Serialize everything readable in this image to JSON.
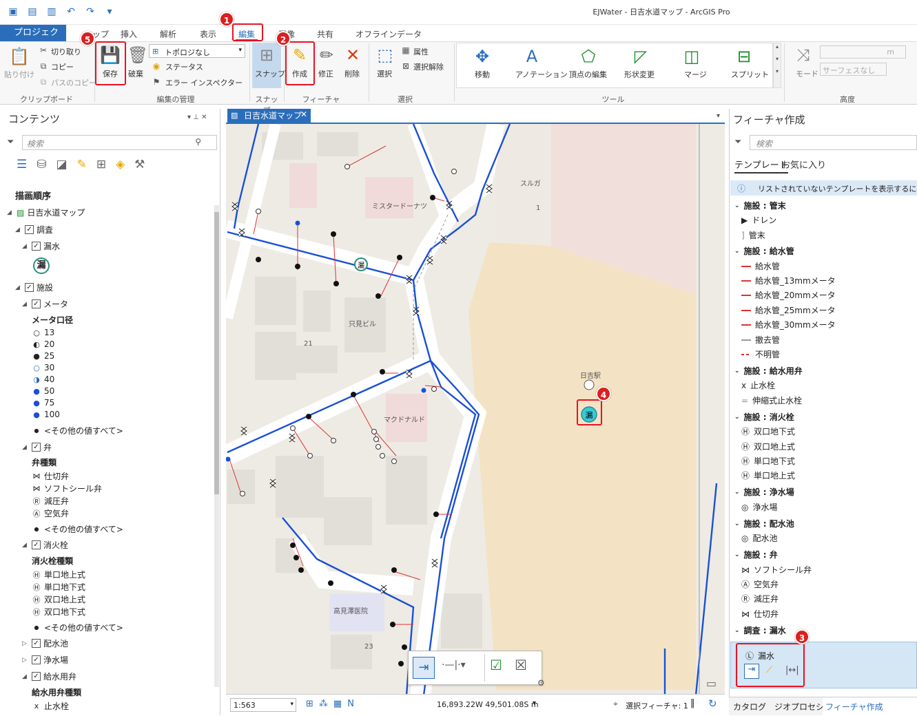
{
  "window": {
    "title": "EJWater - 日吉水道マップ - ArcGIS Pro"
  },
  "tabs": {
    "project": "プロジェクト",
    "map": "マップ",
    "insert": "挿入",
    "analysis": "解析",
    "view": "表示",
    "edit": "編集",
    "imagery": "画像",
    "share": "共有",
    "offline": "オフラインデータ"
  },
  "ribbon": {
    "paste": "貼り付け",
    "cut": "切り取り",
    "copy": "コピー",
    "copy_path": "パスのコピー",
    "clipboard": "クリップボード",
    "save": "保存",
    "discard": "破棄",
    "topology": "トポロジなし",
    "status": "ステータス",
    "error_inspector": "エラー インスペクター",
    "manage_edits": "編集の管理",
    "snap": "スナップ",
    "snapping": "スナップ",
    "create": "作成",
    "modify": "修正",
    "delete": "削除",
    "features": "フィーチャ",
    "select": "選択",
    "attributes": "属性",
    "clear": "選択解除",
    "selection": "選択",
    "move": "移動",
    "annotation": "アノテーション",
    "edit_vertices": "頂点の編集",
    "reshape": "形状変更",
    "merge": "マージ",
    "split": "スプリット",
    "tools": "ツール",
    "mode": "モード",
    "surface": "サーフェスなし",
    "unit": "m",
    "elevation": "高度"
  },
  "badges": [
    "1",
    "2",
    "3",
    "4",
    "5"
  ],
  "contents": {
    "title": "コンテンツ",
    "search_placeholder": "検索",
    "drawing_order": "描画順序",
    "map_name": "日吉水道マップ",
    "survey": "調査",
    "leak": "漏水",
    "leak_symbol": "漏",
    "facilities": "施設",
    "meter": "メータ",
    "meter_field": "メータ口径",
    "meter_classes": [
      "13",
      "20",
      "25",
      "30",
      "40",
      "50",
      "75",
      "100"
    ],
    "other": "<その他の値すべて>",
    "valve": "弁",
    "valve_field": "弁種類",
    "valve_classes": [
      "仕切弁",
      "ソフトシール弁",
      "減圧弁",
      "空気弁"
    ],
    "hydrant": "消火栓",
    "hydrant_field": "消火栓種類",
    "hydrant_classes": [
      "単口地上式",
      "単口地下式",
      "双口地上式",
      "双口地下式"
    ],
    "reservoir": "配水池",
    "plant": "浄水場",
    "supply_valve": "給水用弁",
    "supply_valve_field": "給水用弁種類",
    "stop_cock": "止水栓"
  },
  "map": {
    "tab": "日吉水道マップ",
    "labels": {
      "suruga": "スルガ",
      "one": "1",
      "mister_donut": "ミスタードーナツ",
      "tadami": "只見ビル",
      "n21": "21",
      "station": "日吉駅",
      "mcd": "マクドナルド",
      "clinic": "高見澤医院",
      "n23": "23",
      "leak": "漏"
    }
  },
  "statusbar": {
    "scale": "1:563",
    "coords": "16,893.22W 49,501.08S m",
    "selected": "選択フィーチャ: 1"
  },
  "create_panel": {
    "title": "フィーチャ作成",
    "search_placeholder": "検索",
    "tab_templates": "テンプレート",
    "tab_favorites": "お気に入り",
    "info": "リストされていないテンプレートを表示するには、ここ",
    "groups": [
      {
        "title": "施設 : 管末",
        "items": [
          "ドレン",
          "管末"
        ]
      },
      {
        "title": "施設 : 給水管",
        "items": [
          "給水管",
          "給水管_13mmメータ",
          "給水管_20mmメータ",
          "給水管_25mmメータ",
          "給水管_30mmメータ",
          "撤去管",
          "不明管"
        ]
      },
      {
        "title": "施設 : 給水用弁",
        "items": [
          "止水栓",
          "伸縮式止水栓"
        ]
      },
      {
        "title": "施設 : 消火栓",
        "items": [
          "双口地下式",
          "双口地上式",
          "単口地下式",
          "単口地上式"
        ]
      },
      {
        "title": "施設 : 浄水場",
        "items": [
          "浄水場"
        ]
      },
      {
        "title": "施設 : 配水池",
        "items": [
          "配水池"
        ]
      },
      {
        "title": "施設 : 弁",
        "items": [
          "ソフトシール弁",
          "空気弁",
          "減圧弁",
          "仕切弁"
        ]
      },
      {
        "title": "調査 : 漏水",
        "items": [
          "漏水"
        ]
      }
    ]
  },
  "bottom_tabs": {
    "catalog": "カタログ",
    "geoprocessing": "ジオプロセシング",
    "create": "フィーチャ作成"
  },
  "colors": {
    "accent": "#2a6ebb",
    "badge": "#d9201f",
    "water_main": "#1a4fd6",
    "service_line": "#e03030",
    "station_area": "#f3e3c4"
  }
}
